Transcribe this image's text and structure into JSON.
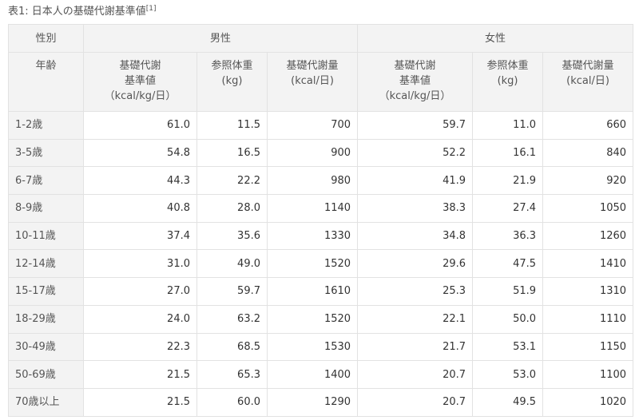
{
  "caption": {
    "text": "表1: 日本人の基礎代謝基準値",
    "ref": "[1]"
  },
  "header": {
    "sex_label": "性別",
    "male_label": "男性",
    "female_label": "女性",
    "age_label": "年齢",
    "columns": {
      "bmr_ref": "基礎代謝\n基準値\n（kcal/kg/日）",
      "weight": "参照体重\n(kg)",
      "bmr": "基礎代謝量\n(kcal/日)"
    }
  },
  "rows": [
    {
      "age": "1-2歳",
      "male_ref": "61.0",
      "male_weight": "11.5",
      "male_bmr": "700",
      "female_ref": "59.7",
      "female_weight": "11.0",
      "female_bmr": "660"
    },
    {
      "age": "3-5歳",
      "male_ref": "54.8",
      "male_weight": "16.5",
      "male_bmr": "900",
      "female_ref": "52.2",
      "female_weight": "16.1",
      "female_bmr": "840"
    },
    {
      "age": "6-7歳",
      "male_ref": "44.3",
      "male_weight": "22.2",
      "male_bmr": "980",
      "female_ref": "41.9",
      "female_weight": "21.9",
      "female_bmr": "920"
    },
    {
      "age": "8-9歳",
      "male_ref": "40.8",
      "male_weight": "28.0",
      "male_bmr": "1140",
      "female_ref": "38.3",
      "female_weight": "27.4",
      "female_bmr": "1050"
    },
    {
      "age": "10-11歳",
      "male_ref": "37.4",
      "male_weight": "35.6",
      "male_bmr": "1330",
      "female_ref": "34.8",
      "female_weight": "36.3",
      "female_bmr": "1260"
    },
    {
      "age": "12-14歳",
      "male_ref": "31.0",
      "male_weight": "49.0",
      "male_bmr": "1520",
      "female_ref": "29.6",
      "female_weight": "47.5",
      "female_bmr": "1410"
    },
    {
      "age": "15-17歳",
      "male_ref": "27.0",
      "male_weight": "59.7",
      "male_bmr": "1610",
      "female_ref": "25.3",
      "female_weight": "51.9",
      "female_bmr": "1310"
    },
    {
      "age": "18-29歳",
      "male_ref": "24.0",
      "male_weight": "63.2",
      "male_bmr": "1520",
      "female_ref": "22.1",
      "female_weight": "50.0",
      "female_bmr": "1110"
    },
    {
      "age": "30-49歳",
      "male_ref": "22.3",
      "male_weight": "68.5",
      "male_bmr": "1530",
      "female_ref": "21.7",
      "female_weight": "53.1",
      "female_bmr": "1150"
    },
    {
      "age": "50-69歳",
      "male_ref": "21.5",
      "male_weight": "65.3",
      "male_bmr": "1400",
      "female_ref": "20.7",
      "female_weight": "53.0",
      "female_bmr": "1100"
    },
    {
      "age": "70歳以上",
      "male_ref": "21.5",
      "male_weight": "60.0",
      "male_bmr": "1290",
      "female_ref": "20.7",
      "female_weight": "49.5",
      "female_bmr": "1020"
    }
  ]
}
